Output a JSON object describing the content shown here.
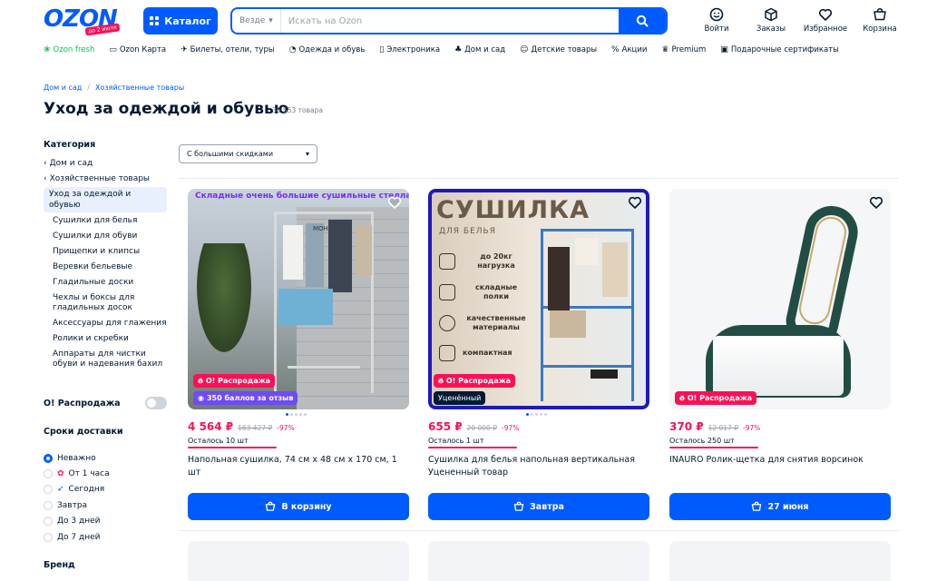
{
  "header": {
    "logo": "OZON",
    "logo_badge": "до 2 июля",
    "catalog_label": "Каталог",
    "search_scope": "Везде",
    "search_placeholder": "Искать на Ozon",
    "icons": [
      {
        "label": "Войти",
        "icon": "smile-icon"
      },
      {
        "label": "Заказы",
        "icon": "box-icon"
      },
      {
        "label": "Избранное",
        "icon": "heart-icon"
      },
      {
        "label": "Корзина",
        "icon": "cart-icon"
      }
    ]
  },
  "nav": [
    {
      "label": "Ozon fresh",
      "icon": "fresh-icon"
    },
    {
      "label": "Ozon Карта",
      "icon": "card-icon"
    },
    {
      "label": "Билеты, отели, туры",
      "icon": "plane-icon"
    },
    {
      "label": "Одежда и обувь",
      "icon": "clothes-icon"
    },
    {
      "label": "Электроника",
      "icon": "phone-icon"
    },
    {
      "label": "Дом и сад",
      "icon": "plant-icon"
    },
    {
      "label": "Детские товары",
      "icon": "kid-icon"
    },
    {
      "label": "Акции",
      "icon": "percent-icon"
    },
    {
      "label": "Premium",
      "icon": "crown-icon"
    },
    {
      "label": "Подарочные сертификаты",
      "icon": "gift-icon"
    }
  ],
  "breadcrumb": [
    "Дом и сад",
    "Хозяйственные товары"
  ],
  "page_title": "Уход за одеждой и обувью",
  "product_count": "36 553 товара",
  "sidebar": {
    "category_head": "Категория",
    "parents": [
      "Дом и сад",
      "Хозяйственные товары"
    ],
    "current": "Уход за одеждой и обувью",
    "subcategories": [
      "Сушилки для белья",
      "Сушилки для обуви",
      "Прищепки и клипсы",
      "Веревки бельевые",
      "Гладильные доски",
      "Чехлы и боксы для гладильных досок",
      "Аксессуары для глажения",
      "Ролики и скребки",
      "Аппараты для чистки обуви и надевания бахил"
    ],
    "sale_toggle": "О! Распродажа",
    "delivery_head": "Сроки доставки",
    "delivery_options": [
      "Неважно",
      "От 1 часа",
      "Сегодня",
      "Завтра",
      "До 3 дней",
      "До 7 дней"
    ],
    "delivery_selected": 0,
    "brand_head": "Бренд"
  },
  "sort": {
    "selected": "С большими скидками"
  },
  "products": [
    {
      "image_title": "Складные очень большие сушильные стелла",
      "image_label": "МОН",
      "sale_badge": "О! Распродажа",
      "points_badge": "350 баллов за отзыв",
      "price": "4 564 ₽",
      "old_price": "163 427 ₽",
      "discount": "-97%",
      "left": "Осталось 10 шт",
      "name": "Напольная сушилка, 74 см х 48 см х 170 см, 1 шт",
      "button": "В корзину"
    },
    {
      "image_big": "СУШИЛКА",
      "image_sub": "ДЛЯ БЕЛЬЯ",
      "image_features": [
        "до 20кг нагрузка",
        "складные полки",
        "качественные материалы",
        "компактная"
      ],
      "sale_badge": "О! Распродажа",
      "used_badge": "Уценённый",
      "price": "655 ₽",
      "old_price": "20 000 ₽",
      "discount": "-97%",
      "left": "Осталось 1 шт",
      "name": "Сушилка для белья напольная вертикальная Уцененный товар",
      "button": "Завтра"
    },
    {
      "sale_badge": "О! Распродажа",
      "price": "370 ₽",
      "old_price": "12 017 ₽",
      "discount": "-97%",
      "left": "Осталось 250 шт",
      "name": "INAURO Ролик-щетка для снятия ворсинок",
      "button": "27 июня"
    }
  ]
}
